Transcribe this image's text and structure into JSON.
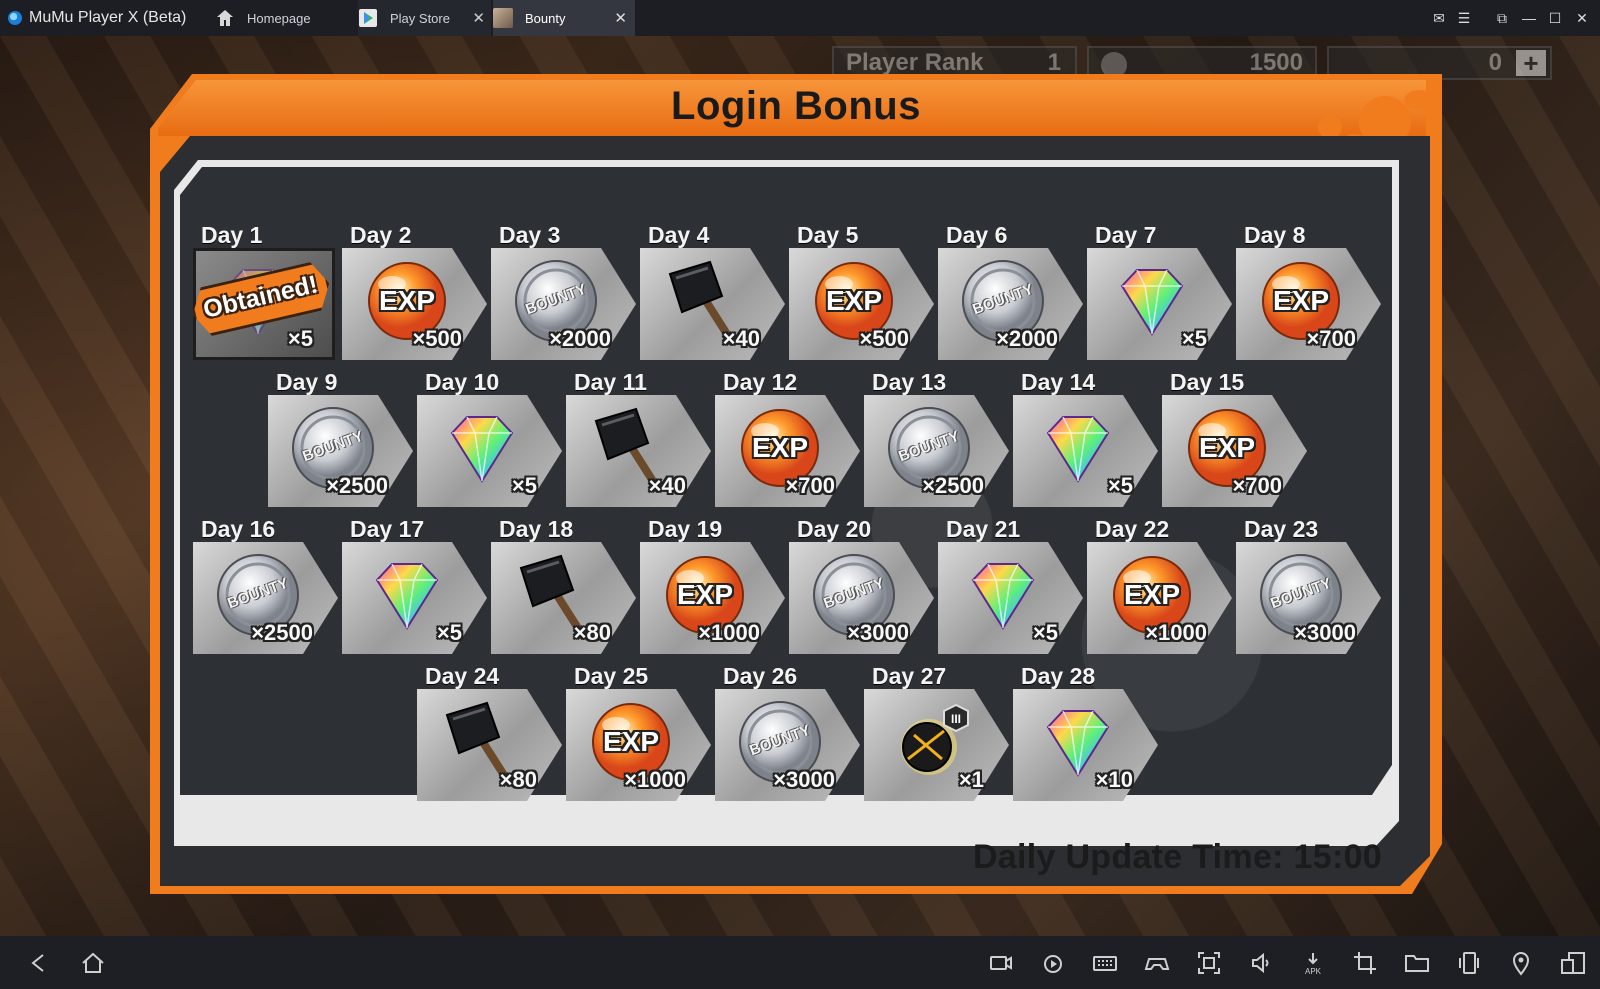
{
  "window": {
    "app_title": "MuMu Player X  (Beta)",
    "tabs": [
      {
        "label": "Homepage",
        "icon": "home-icon"
      },
      {
        "label": "Play Store",
        "icon": "play-store-icon"
      },
      {
        "label": "Bounty",
        "icon": "game-icon"
      }
    ]
  },
  "hud": {
    "rank_label": "Player Rank",
    "rank_value": "1",
    "coins": "1500",
    "gems": "0"
  },
  "panel": {
    "title": "Login Bonus",
    "update_time": "Daily Update Time: 15:00",
    "obtained_label": "Obtained!"
  },
  "days": [
    {
      "label": "Day 1",
      "item": "gem",
      "qty": "×5",
      "obtained": true
    },
    {
      "label": "Day 2",
      "item": "exp",
      "qty": "×500"
    },
    {
      "label": "Day 3",
      "item": "coin",
      "qty": "×2000"
    },
    {
      "label": "Day 4",
      "item": "hammer",
      "qty": "×40"
    },
    {
      "label": "Day 5",
      "item": "exp",
      "qty": "×500"
    },
    {
      "label": "Day 6",
      "item": "coin",
      "qty": "×2000"
    },
    {
      "label": "Day 7",
      "item": "gem",
      "qty": "×5"
    },
    {
      "label": "Day 8",
      "item": "exp",
      "qty": "×700"
    },
    {
      "label": "Day 9",
      "item": "coin",
      "qty": "×2500"
    },
    {
      "label": "Day 10",
      "item": "gem",
      "qty": "×5"
    },
    {
      "label": "Day 11",
      "item": "hammer",
      "qty": "×40"
    },
    {
      "label": "Day 12",
      "item": "exp",
      "qty": "×700"
    },
    {
      "label": "Day 13",
      "item": "coin",
      "qty": "×2500"
    },
    {
      "label": "Day 14",
      "item": "gem",
      "qty": "×5"
    },
    {
      "label": "Day 15",
      "item": "exp",
      "qty": "×700"
    },
    {
      "label": "Day 16",
      "item": "coin",
      "qty": "×2500"
    },
    {
      "label": "Day 17",
      "item": "gem",
      "qty": "×5"
    },
    {
      "label": "Day 18",
      "item": "hammer",
      "qty": "×80"
    },
    {
      "label": "Day 19",
      "item": "exp",
      "qty": "×1000"
    },
    {
      "label": "Day 20",
      "item": "coin",
      "qty": "×3000"
    },
    {
      "label": "Day 21",
      "item": "gem",
      "qty": "×5"
    },
    {
      "label": "Day 22",
      "item": "exp",
      "qty": "×1000"
    },
    {
      "label": "Day 23",
      "item": "coin",
      "qty": "×3000"
    },
    {
      "label": "Day 24",
      "item": "hammer",
      "qty": "×80"
    },
    {
      "label": "Day 25",
      "item": "exp",
      "qty": "×1000"
    },
    {
      "label": "Day 26",
      "item": "coin",
      "qty": "×3000"
    },
    {
      "label": "Day 27",
      "item": "bomb",
      "qty": "×1",
      "badge": "III"
    },
    {
      "label": "Day 28",
      "item": "gem",
      "qty": "×10"
    }
  ],
  "item_text": {
    "exp": "EXP",
    "coin": "BOUNTY"
  },
  "colors": {
    "accent_orange": "#f07c1e",
    "panel_dark": "#2d3034",
    "tile_gray": "#bdbdbd"
  },
  "bottom_nav": [
    "back-icon",
    "home-icon"
  ],
  "toolbar": [
    "record-icon",
    "replay-icon",
    "keyboard-icon",
    "gamepad-icon",
    "screenshot-icon",
    "volume-icon",
    "apk-icon",
    "crop-icon",
    "folder-icon",
    "rotate-icon",
    "location-icon",
    "multi-window-icon"
  ]
}
